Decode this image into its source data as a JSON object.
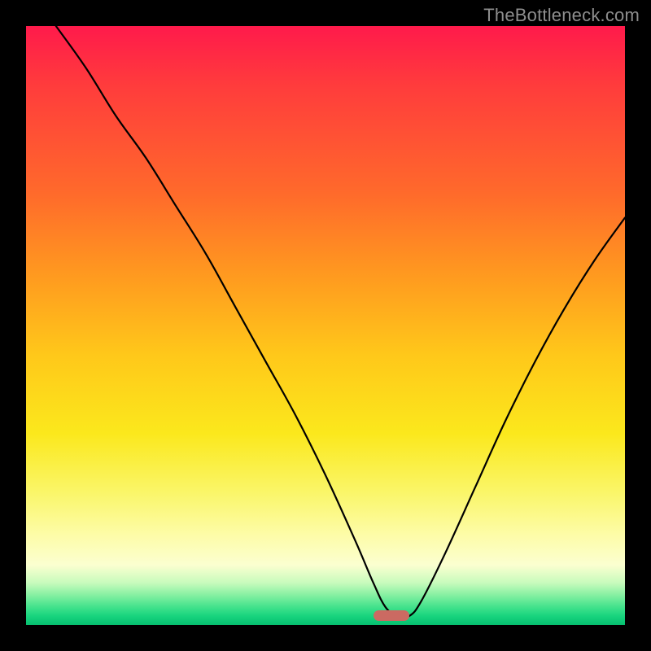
{
  "watermark": {
    "text": "TheBottleneck.com"
  },
  "colors": {
    "frame": "#000000",
    "marker": "#cb6a62",
    "curve": "#000000",
    "gradient_stops": [
      "#ff1a4b",
      "#ff3c3c",
      "#ff6a2b",
      "#ff9b1f",
      "#ffc81a",
      "#fbe81c",
      "#faf66a",
      "#fdfca8",
      "#fbffd0",
      "#c7fbbc",
      "#86f0a2",
      "#43e28c",
      "#18d47e",
      "#06bf70"
    ]
  },
  "chart_data": {
    "type": "line",
    "title": "",
    "xlabel": "",
    "ylabel": "",
    "xlim": [
      0,
      100
    ],
    "ylim": [
      0,
      100
    ],
    "grid": false,
    "legend": false,
    "annotations": [
      {
        "name": "optimal-marker",
        "x": 61,
        "y": 1.5,
        "shape": "pill"
      }
    ],
    "series": [
      {
        "name": "bottleneck-curve",
        "x": [
          5,
          10,
          15,
          20,
          25,
          30,
          35,
          40,
          45,
          50,
          55,
          58,
          60,
          62,
          64,
          66,
          70,
          75,
          80,
          85,
          90,
          95,
          100
        ],
        "values": [
          100,
          93,
          85,
          78,
          70,
          62,
          53,
          44,
          35,
          25,
          14,
          7,
          3,
          1.5,
          1.5,
          4,
          12,
          23,
          34,
          44,
          53,
          61,
          68
        ]
      }
    ]
  }
}
